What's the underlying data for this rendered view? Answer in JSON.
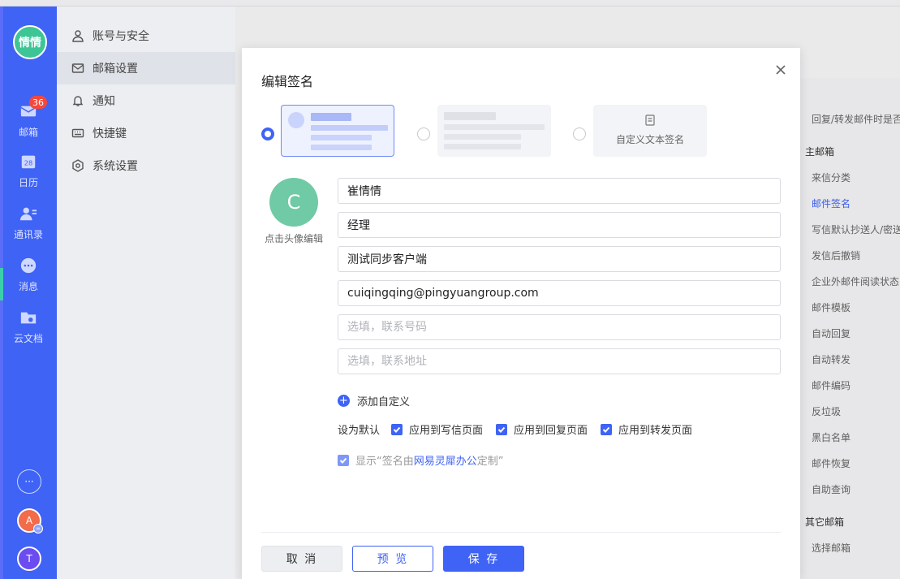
{
  "rail": {
    "user_avatar_text": "情情",
    "mail_badge": "36",
    "items": [
      {
        "label": "邮箱",
        "icon": "mail-icon"
      },
      {
        "label": "日历",
        "icon": "calendar-icon",
        "icon_text": "28"
      },
      {
        "label": "通讯录",
        "icon": "contacts-icon"
      },
      {
        "label": "消息",
        "icon": "message-icon"
      },
      {
        "label": "云文档",
        "icon": "cloud-doc-icon"
      }
    ],
    "more_text": "···",
    "account_a": "A",
    "account_t": "T"
  },
  "settings_menu": {
    "items": [
      {
        "label": "账号与安全",
        "icon": "user-icon"
      },
      {
        "label": "邮箱设置",
        "icon": "mail-outline-icon"
      },
      {
        "label": "通知",
        "icon": "bell-icon"
      },
      {
        "label": "快捷键",
        "icon": "keyboard-icon"
      },
      {
        "label": "系统设置",
        "icon": "gear-icon"
      }
    ]
  },
  "right_list": {
    "items": [
      {
        "label": "回复/转发邮件时是否",
        "type": "item"
      },
      {
        "label": "主邮箱",
        "type": "hdr"
      },
      {
        "label": "来信分类",
        "type": "item"
      },
      {
        "label": "邮件签名",
        "type": "sel"
      },
      {
        "label": "写信默认抄送人/密送",
        "type": "item"
      },
      {
        "label": "发信后撤销",
        "type": "item"
      },
      {
        "label": "企业外邮件阅读状态",
        "type": "item"
      },
      {
        "label": "邮件模板",
        "type": "item"
      },
      {
        "label": "自动回复",
        "type": "item"
      },
      {
        "label": "自动转发",
        "type": "item"
      },
      {
        "label": "邮件编码",
        "type": "item"
      },
      {
        "label": "反垃圾",
        "type": "item"
      },
      {
        "label": "黑白名单",
        "type": "item"
      },
      {
        "label": "邮件恢复",
        "type": "item"
      },
      {
        "label": "自助查询",
        "type": "item"
      },
      {
        "label": "其它邮箱",
        "type": "hdr"
      },
      {
        "label": "选择邮箱",
        "type": "item"
      }
    ]
  },
  "modal": {
    "title": "编辑签名",
    "custom_text_template": "自定义文本签名",
    "avatar_letter": "C",
    "avatar_hint": "点击头像编辑",
    "fields": {
      "name": "崔情情",
      "position": "经理",
      "company": "测试同步客户端",
      "email": "cuiqingqing@pingyuangroup.com",
      "phone_placeholder": "选填，联系号码",
      "address_placeholder": "选填，联系地址"
    },
    "add_custom": "添加自定义",
    "set_default_label": "设为默认",
    "default_options": [
      "应用到写信页面",
      "应用到回复页面",
      "应用到转发页面"
    ],
    "show_prefix": "显示“签名由",
    "show_brand": "网易灵犀办公",
    "show_suffix": "定制”",
    "buttons": {
      "cancel": "取 消",
      "preview": "预 览",
      "save": "保 存"
    }
  },
  "colors": {
    "accent": "#3f63f5",
    "rail": "#3f63f5",
    "avatar_green": "#6fcaa5"
  }
}
